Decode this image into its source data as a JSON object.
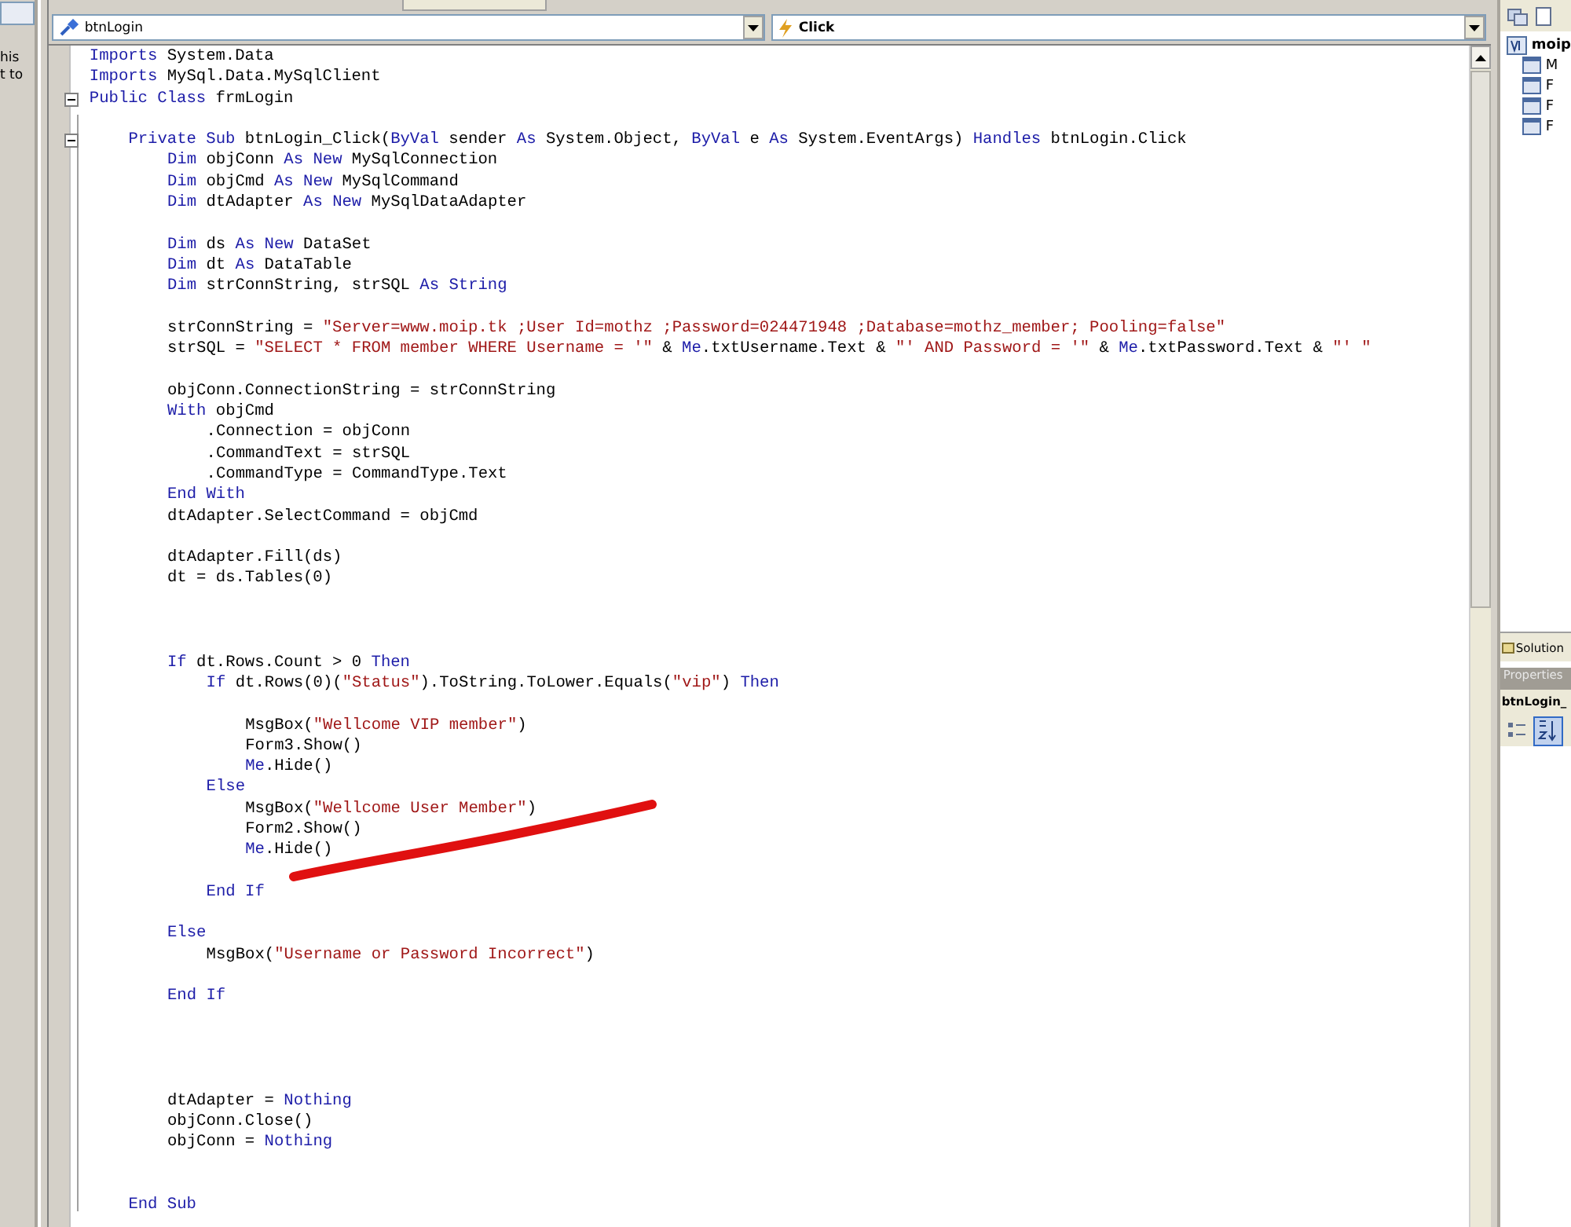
{
  "left_panel": {
    "texts": [
      "his",
      "t to"
    ]
  },
  "editor": {
    "object_combo": {
      "value": "btnLogin"
    },
    "event_combo": {
      "value": "Click"
    },
    "lines": [
      {
        "kind": "code",
        "tokens": [
          {
            "kind": "kw",
            "text": "Imports"
          },
          {
            "kind": "plain",
            "text": " System.Data"
          }
        ]
      },
      {
        "kind": "code",
        "tokens": [
          {
            "kind": "kw",
            "text": "Imports"
          },
          {
            "kind": "plain",
            "text": " MySql.Data.MySqlClient"
          }
        ]
      },
      {
        "kind": "code",
        "fold": true,
        "tokens": [
          {
            "kind": "kw",
            "text": "Public Class"
          },
          {
            "kind": "plain",
            "text": " frmLogin"
          }
        ],
        "children": [
          {
            "kind": "blank"
          },
          {
            "kind": "code",
            "fold": true,
            "tokens": [
              {
                "kind": "kw",
                "text": "Private Sub"
              },
              {
                "kind": "plain",
                "text": " btnLogin_Click("
              },
              {
                "kind": "kw",
                "text": "ByVal"
              },
              {
                "kind": "plain",
                "text": " sender "
              },
              {
                "kind": "kw",
                "text": "As"
              },
              {
                "kind": "plain",
                "text": " System.Object, "
              },
              {
                "kind": "kw",
                "text": "ByVal"
              },
              {
                "kind": "plain",
                "text": " e "
              },
              {
                "kind": "kw",
                "text": "As"
              },
              {
                "kind": "plain",
                "text": " System.EventArgs) "
              },
              {
                "kind": "kw",
                "text": "Handles"
              },
              {
                "kind": "plain",
                "text": " btnLogin.Click"
              }
            ],
            "children": [
              {
                "kind": "code",
                "tokens": [
                  {
                    "kind": "kw",
                    "text": "Dim"
                  },
                  {
                    "kind": "plain",
                    "text": " objConn "
                  },
                  {
                    "kind": "kw",
                    "text": "As New"
                  },
                  {
                    "kind": "plain",
                    "text": " MySqlConnection"
                  }
                ]
              },
              {
                "kind": "code",
                "tokens": [
                  {
                    "kind": "kw",
                    "text": "Dim"
                  },
                  {
                    "kind": "plain",
                    "text": " objCmd "
                  },
                  {
                    "kind": "kw",
                    "text": "As New"
                  },
                  {
                    "kind": "plain",
                    "text": " MySqlCommand"
                  }
                ]
              },
              {
                "kind": "code",
                "tokens": [
                  {
                    "kind": "kw",
                    "text": "Dim"
                  },
                  {
                    "kind": "plain",
                    "text": " dtAdapter "
                  },
                  {
                    "kind": "kw",
                    "text": "As New"
                  },
                  {
                    "kind": "plain",
                    "text": " MySqlDataAdapter"
                  }
                ]
              },
              {
                "kind": "blank"
              },
              {
                "kind": "code",
                "tokens": [
                  {
                    "kind": "kw",
                    "text": "Dim"
                  },
                  {
                    "kind": "plain",
                    "text": " ds "
                  },
                  {
                    "kind": "kw",
                    "text": "As New"
                  },
                  {
                    "kind": "plain",
                    "text": " DataSet"
                  }
                ]
              },
              {
                "kind": "code",
                "tokens": [
                  {
                    "kind": "kw",
                    "text": "Dim"
                  },
                  {
                    "kind": "plain",
                    "text": " dt "
                  },
                  {
                    "kind": "kw",
                    "text": "As"
                  },
                  {
                    "kind": "plain",
                    "text": " DataTable"
                  }
                ]
              },
              {
                "kind": "code",
                "tokens": [
                  {
                    "kind": "kw",
                    "text": "Dim"
                  },
                  {
                    "kind": "plain",
                    "text": " strConnString, strSQL "
                  },
                  {
                    "kind": "kw",
                    "text": "As String"
                  }
                ]
              },
              {
                "kind": "blank"
              },
              {
                "kind": "code",
                "tokens": [
                  {
                    "kind": "plain",
                    "text": "strConnString = "
                  },
                  {
                    "kind": "str",
                    "text": "\"Server=www.moip.tk ;User Id=mothz ;Password=024471948 ;Database=mothz_member; Pooling=false\""
                  }
                ]
              },
              {
                "kind": "code",
                "tokens": [
                  {
                    "kind": "plain",
                    "text": "strSQL = "
                  },
                  {
                    "kind": "str",
                    "text": "\"SELECT * FROM member WHERE Username = '\""
                  },
                  {
                    "kind": "plain",
                    "text": " & "
                  },
                  {
                    "kind": "kw",
                    "text": "Me"
                  },
                  {
                    "kind": "plain",
                    "text": ".txtUsername.Text & "
                  },
                  {
                    "kind": "str",
                    "text": "\"' AND Password = '\""
                  },
                  {
                    "kind": "plain",
                    "text": " & "
                  },
                  {
                    "kind": "kw",
                    "text": "Me"
                  },
                  {
                    "kind": "plain",
                    "text": ".txtPassword.Text & "
                  },
                  {
                    "kind": "str",
                    "text": "\"' \""
                  }
                ]
              },
              {
                "kind": "blank"
              },
              {
                "kind": "code",
                "tokens": [
                  {
                    "kind": "plain",
                    "text": "objConn.ConnectionString = strConnString"
                  }
                ]
              },
              {
                "kind": "code",
                "tokens": [
                  {
                    "kind": "kw",
                    "text": "With"
                  },
                  {
                    "kind": "plain",
                    "text": " objCmd"
                  }
                ],
                "children": [
                  {
                    "kind": "code",
                    "tokens": [
                      {
                        "kind": "plain",
                        "text": ".Connection = objConn"
                      }
                    ]
                  },
                  {
                    "kind": "code",
                    "tokens": [
                      {
                        "kind": "plain",
                        "text": ".CommandText = strSQL"
                      }
                    ]
                  },
                  {
                    "kind": "code",
                    "tokens": [
                      {
                        "kind": "plain",
                        "text": ".CommandType = CommandType.Text"
                      }
                    ]
                  }
                ]
              },
              {
                "kind": "code",
                "tokens": [
                  {
                    "kind": "kw",
                    "text": "End With"
                  }
                ]
              },
              {
                "kind": "code",
                "tokens": [
                  {
                    "kind": "plain",
                    "text": "dtAdapter.SelectCommand = objCmd"
                  }
                ]
              },
              {
                "kind": "blank"
              },
              {
                "kind": "code",
                "tokens": [
                  {
                    "kind": "plain",
                    "text": "dtAdapter.Fill(ds)"
                  }
                ]
              },
              {
                "kind": "code",
                "tokens": [
                  {
                    "kind": "plain",
                    "text": "dt = ds.Tables(0)"
                  }
                ]
              },
              {
                "kind": "blank"
              },
              {
                "kind": "blank"
              },
              {
                "kind": "blank"
              },
              {
                "kind": "code",
                "tokens": [
                  {
                    "kind": "kw",
                    "text": "If"
                  },
                  {
                    "kind": "plain",
                    "text": " dt.Rows.Count > 0 "
                  },
                  {
                    "kind": "kw",
                    "text": "Then"
                  }
                ],
                "children": [
                  {
                    "kind": "code",
                    "tokens": [
                      {
                        "kind": "kw",
                        "text": "If"
                      },
                      {
                        "kind": "plain",
                        "text": " dt.Rows(0)("
                      },
                      {
                        "kind": "str",
                        "text": "\"Status\""
                      },
                      {
                        "kind": "plain",
                        "text": ").ToString.ToLower.Equals("
                      },
                      {
                        "kind": "str",
                        "text": "\"vip\""
                      },
                      {
                        "kind": "plain",
                        "text": ") "
                      },
                      {
                        "kind": "kw",
                        "text": "Then"
                      }
                    ],
                    "children": [
                      {
                        "kind": "blank"
                      },
                      {
                        "kind": "code",
                        "tokens": [
                          {
                            "kind": "plain",
                            "text": "MsgBox("
                          },
                          {
                            "kind": "str",
                            "text": "\"Wellcome VIP member\""
                          },
                          {
                            "kind": "plain",
                            "text": ")"
                          }
                        ]
                      },
                      {
                        "kind": "code",
                        "tokens": [
                          {
                            "kind": "plain",
                            "text": "Form3.Show()"
                          }
                        ]
                      },
                      {
                        "kind": "code",
                        "tokens": [
                          {
                            "kind": "kw",
                            "text": "Me"
                          },
                          {
                            "kind": "plain",
                            "text": ".Hide()"
                          }
                        ]
                      }
                    ]
                  },
                  {
                    "kind": "code",
                    "tokens": [
                      {
                        "kind": "kw",
                        "text": "Else"
                      }
                    ],
                    "children": [
                      {
                        "kind": "code",
                        "tokens": [
                          {
                            "kind": "plain",
                            "text": "MsgBox("
                          },
                          {
                            "kind": "str",
                            "text": "\"Wellcome User Member\""
                          },
                          {
                            "kind": "plain",
                            "text": ")"
                          }
                        ]
                      },
                      {
                        "kind": "code",
                        "tokens": [
                          {
                            "kind": "plain",
                            "text": "Form2.Show()"
                          }
                        ]
                      },
                      {
                        "kind": "code",
                        "tokens": [
                          {
                            "kind": "kw",
                            "text": "Me"
                          },
                          {
                            "kind": "plain",
                            "text": ".Hide()"
                          }
                        ]
                      },
                      {
                        "kind": "blank"
                      }
                    ]
                  },
                  {
                    "kind": "code",
                    "tokens": [
                      {
                        "kind": "kw",
                        "text": "End If"
                      }
                    ]
                  },
                  {
                    "kind": "blank"
                  }
                ]
              },
              {
                "kind": "code",
                "tokens": [
                  {
                    "kind": "kw",
                    "text": "Else"
                  }
                ],
                "children": [
                  {
                    "kind": "code",
                    "tokens": [
                      {
                        "kind": "plain",
                        "text": "MsgBox("
                      },
                      {
                        "kind": "str",
                        "text": "\"Username or Password Incorrect\""
                      },
                      {
                        "kind": "plain",
                        "text": ")"
                      }
                    ]
                  },
                  {
                    "kind": "blank"
                  }
                ]
              },
              {
                "kind": "code",
                "tokens": [
                  {
                    "kind": "kw",
                    "text": "End If"
                  }
                ]
              },
              {
                "kind": "blank"
              },
              {
                "kind": "blank"
              },
              {
                "kind": "blank"
              },
              {
                "kind": "blank"
              },
              {
                "kind": "code",
                "tokens": [
                  {
                    "kind": "plain",
                    "text": "dtAdapter = "
                  },
                  {
                    "kind": "kw",
                    "text": "Nothing"
                  }
                ]
              },
              {
                "kind": "code",
                "tokens": [
                  {
                    "kind": "plain",
                    "text": "objConn.Close()"
                  }
                ]
              },
              {
                "kind": "code",
                "tokens": [
                  {
                    "kind": "plain",
                    "text": "objConn = "
                  },
                  {
                    "kind": "kw",
                    "text": "Nothing"
                  }
                ]
              },
              {
                "kind": "blank"
              },
              {
                "kind": "blank"
              }
            ]
          },
          {
            "kind": "code",
            "tokens": [
              {
                "kind": "kw",
                "text": "End Sub"
              }
            ]
          }
        ]
      }
    ]
  },
  "solution_explorer": {
    "project": "moip",
    "items": [
      "M",
      "F",
      "F",
      "F"
    ],
    "tab": "Solution"
  },
  "properties": {
    "title": "Properties",
    "object": "btnLogin_"
  }
}
